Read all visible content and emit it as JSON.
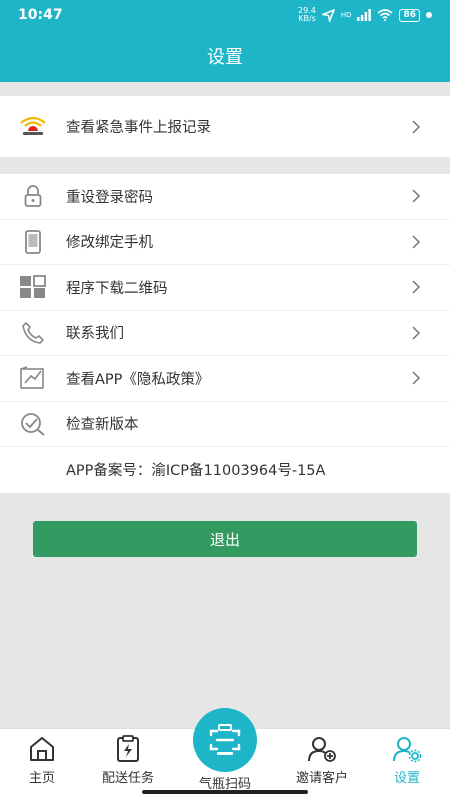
{
  "status": {
    "time": "10:47",
    "network_speed": "29.4\nKB/s",
    "signal_label": "HD",
    "battery": "86"
  },
  "header": {
    "title": "设置"
  },
  "group1": {
    "items": [
      {
        "label": "查看紧急事件上报记录",
        "icon": "alarm-light-icon"
      }
    ]
  },
  "group2": {
    "items": [
      {
        "label": "重设登录密码",
        "icon": "lock-icon"
      },
      {
        "label": "修改绑定手机",
        "icon": "phone-icon"
      },
      {
        "label": "程序下载二维码",
        "icon": "qr-grid-icon"
      },
      {
        "label": "联系我们",
        "icon": "telephone-icon"
      },
      {
        "label": "查看APP《隐私政策》",
        "icon": "policy-icon"
      },
      {
        "label": "检查新版本",
        "icon": "check-magnifier-icon"
      },
      {
        "label": "APP备案号：渝ICP备11003964号-15A"
      }
    ]
  },
  "logout": {
    "label": "退出"
  },
  "tabbar": {
    "active_color": "#1fb5c8",
    "tabs": [
      {
        "label": "主页",
        "icon": "home-icon"
      },
      {
        "label": "配送任务",
        "icon": "clipboard-bolt-icon"
      },
      {
        "label": "气瓶扫码",
        "icon": "scan-icon"
      },
      {
        "label": "邀请客户",
        "icon": "add-user-icon"
      },
      {
        "label": "设置",
        "icon": "user-gear-icon"
      }
    ]
  },
  "colors": {
    "primary": "#1fb5c8",
    "logout": "#339b62",
    "background": "#e6e6e6"
  }
}
